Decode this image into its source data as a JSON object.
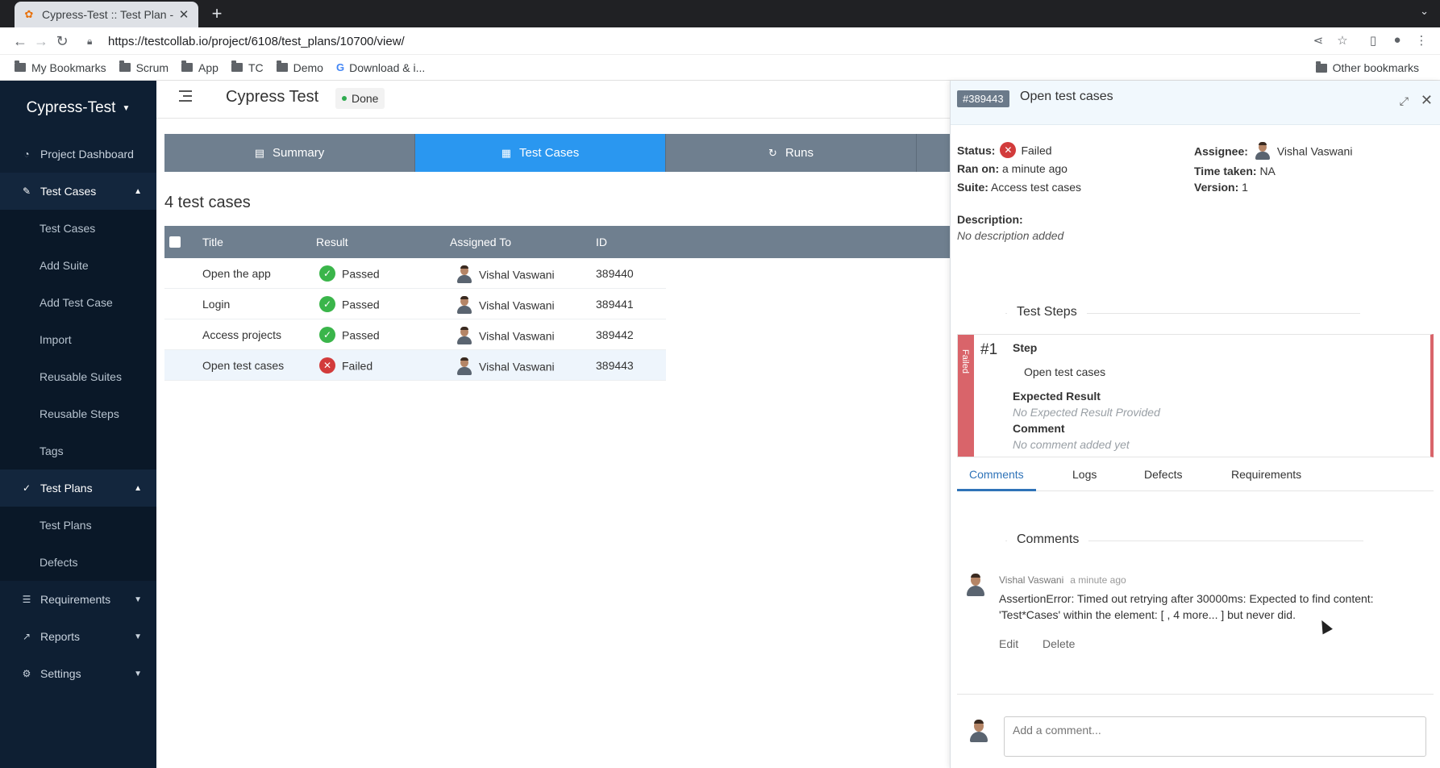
{
  "browser": {
    "tab_title": "Cypress-Test :: Test Plan -",
    "tab_close": "✕",
    "new_tab": "+",
    "url": "https://testcollab.io/project/6108/test_plans/10700/view/",
    "bookmarks": [
      {
        "label": "My Bookmarks",
        "icon": "folder-icon"
      },
      {
        "label": "Scrum",
        "icon": "folder-icon"
      },
      {
        "label": "App",
        "icon": "folder-icon"
      },
      {
        "label": "TC",
        "icon": "folder-icon"
      },
      {
        "label": "Demo",
        "icon": "folder-icon"
      },
      {
        "label": "Download & i...",
        "icon": "google-icon"
      }
    ],
    "other_bookmarks": "Other bookmarks"
  },
  "sidebar": {
    "brand": "Cypress-Test",
    "items": [
      {
        "label": "Project Dashboard",
        "icon": "dashboard-icon"
      },
      {
        "label": "Test Cases",
        "icon": "edit-icon",
        "expanded": true
      },
      {
        "label": "Test Cases",
        "sub": true
      },
      {
        "label": "Add Suite",
        "sub": true
      },
      {
        "label": "Add Test Case",
        "sub": true
      },
      {
        "label": "Import",
        "sub": true
      },
      {
        "label": "Reusable Suites",
        "sub": true
      },
      {
        "label": "Reusable Steps",
        "sub": true
      },
      {
        "label": "Tags",
        "sub": true
      },
      {
        "label": "Test Plans",
        "icon": "check-circle-icon",
        "expanded": true
      },
      {
        "label": "Test Plans",
        "sub": true
      },
      {
        "label": "Defects",
        "sub": true
      },
      {
        "label": "Requirements",
        "icon": "list-icon"
      },
      {
        "label": "Reports",
        "icon": "chart-icon"
      },
      {
        "label": "Settings",
        "icon": "gear-icon"
      }
    ]
  },
  "header": {
    "title": "Cypress Test",
    "status": "Done"
  },
  "main_tabs": [
    {
      "label": "Summary"
    },
    {
      "label": "Test Cases"
    },
    {
      "label": "Runs"
    }
  ],
  "case_count": "4 test cases",
  "table": {
    "headers": {
      "title": "Title",
      "result": "Result",
      "assigned": "Assigned To",
      "id": "ID"
    },
    "rows": [
      {
        "title": "Open the app",
        "result": "Passed",
        "assigned": "Vishal Vaswani",
        "id": "389440"
      },
      {
        "title": "Login",
        "result": "Passed",
        "assigned": "Vishal Vaswani",
        "id": "389441"
      },
      {
        "title": "Access projects",
        "result": "Passed",
        "assigned": "Vishal Vaswani",
        "id": "389442"
      },
      {
        "title": "Open test cases",
        "result": "Failed",
        "assigned": "Vishal Vaswani",
        "id": "389443"
      }
    ]
  },
  "panel": {
    "id_badge": "#389443",
    "title": "Open test cases",
    "status_label": "Status:",
    "status_value": "Failed",
    "ran_label": "Ran on:",
    "ran_value": "a minute ago",
    "suite_label": "Suite:",
    "suite_value": "Access test cases",
    "assignee_label": "Assignee:",
    "assignee_value": "Vishal Vaswani",
    "time_label": "Time taken:",
    "time_value": "NA",
    "version_label": "Version:",
    "version_value": "1",
    "description_label": "Description:",
    "description_value": "No description added",
    "steps_title": "Test Steps",
    "step": {
      "status": "Failed",
      "number": "#1",
      "step_label": "Step",
      "step_text": "Open test cases",
      "expected_label": "Expected Result",
      "expected_value": "No Expected Result Provided",
      "comment_label": "Comment",
      "comment_value": "No comment added yet"
    },
    "sub_tabs": [
      "Comments",
      "Logs",
      "Defects",
      "Requirements"
    ],
    "comments_title": "Comments",
    "comment": {
      "author": "Vishal Vaswani",
      "time": "a minute ago",
      "text": "AssertionError: Timed out retrying after 30000ms: Expected to find content: 'Test*Cases' within the element: [ , 4 more... ] but never did.",
      "edit": "Edit",
      "delete": "Delete"
    },
    "add_comment_placeholder": "Add a comment..."
  }
}
